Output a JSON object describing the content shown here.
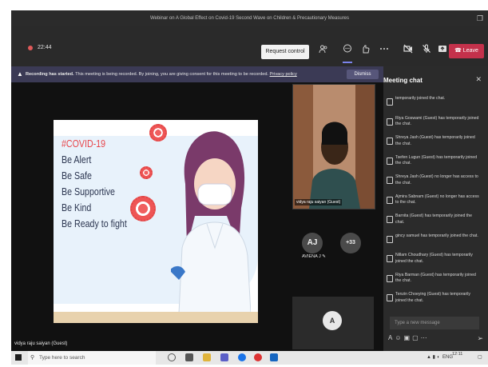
{
  "window": {
    "title": "Webinar on A Global Effect on Covid-19 Second Wave on Children & Precautionary Measures",
    "restore_glyph": "❐"
  },
  "toolbar": {
    "timer": "22:44",
    "request_control": "Request control",
    "leave": "Leave",
    "icons": [
      "people-icon",
      "chat-icon",
      "reactions-icon",
      "more-icon",
      "camera-off-icon",
      "mic-off-icon",
      "share-icon"
    ]
  },
  "banner": {
    "bold": "Recording has started.",
    "text": " This meeting is being recorded. By joining, you are giving consent for this meeting to be recorded. ",
    "link": "Privacy policy",
    "dismiss": "Dismiss"
  },
  "slide": {
    "lines": [
      "#COVID-19",
      "Be Alert",
      "Be Safe",
      "Be Supportive",
      "Be Kind",
      "Be Ready to fight"
    ]
  },
  "self_video": {
    "name": "vidya raju saiyan (Guest)"
  },
  "participants": {
    "aj_initials": "AJ",
    "aj_label": "AVIENA J",
    "overflow": "+33",
    "other_initial": "A",
    "presenter": "vidya raju saiyan (Guest)"
  },
  "chat": {
    "title": "Meeting chat",
    "items": [
      "temporarily joined the chat.",
      "Riya Goswami (Guest) has temporarily joined the chat.",
      "Shreya Jash (Guest) has temporarily joined the chat.",
      "Tsefen Lugun (Guest) has temporarily joined the chat.",
      "Shreya Jash (Guest) no longer has access to the chat.",
      "Ajmira Sabnam (Guest) no longer has access to the chat.",
      "Barnita (Guest) has temporarily joined the chat.",
      "gincy samuel has temporarily joined the chat.",
      "Nillam Choudhary (Guest) has temporarily joined the chat.",
      "Riya Barman (Guest) has temporarily joined the chat.",
      "Tenzin Choeying (Guest) has temporarily joined the chat."
    ],
    "input_placeholder": "Type a new message"
  },
  "taskbar": {
    "search": "Type here to search",
    "lang": "ENG",
    "time": "12:11"
  }
}
